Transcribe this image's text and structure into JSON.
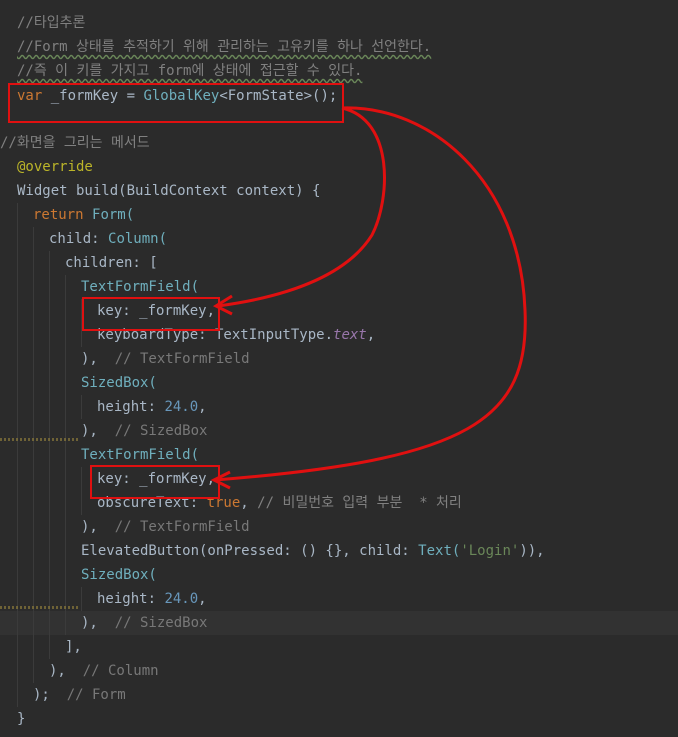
{
  "editor": {
    "lines": [
      {
        "id": "l1",
        "parts": [
          {
            "t": "//타입추론",
            "c": "c-comment"
          }
        ]
      },
      {
        "id": "l2",
        "parts": [
          {
            "t": "//Form 상태를 추적하기 위해 관리하는 고유키를 하나 선언한다.",
            "c": "c-comment"
          }
        ]
      },
      {
        "id": "l3",
        "parts": [
          {
            "t": "//즉 이 키를 가지고 form에 상태에 접근할 수 있다.",
            "c": "c-comment"
          }
        ]
      },
      {
        "id": "l4",
        "parts": [
          {
            "t": "var ",
            "c": "c-kw"
          },
          {
            "t": "_formKey",
            "c": "c-plain"
          },
          {
            "t": " = ",
            "c": "c-plain"
          },
          {
            "t": "GlobalKey",
            "c": "c-cls"
          },
          {
            "t": "<FormState>();",
            "c": "c-plain"
          }
        ]
      },
      {
        "id": "l5",
        "parts": []
      },
      {
        "id": "l6",
        "parts": [
          {
            "t": "//화면을 그리는 메서드",
            "c": "c-comment"
          }
        ]
      },
      {
        "id": "l7",
        "parts": [
          {
            "t": "@override",
            "c": "c-anno"
          }
        ]
      },
      {
        "id": "l8",
        "parts": [
          {
            "t": "Widget build(BuildContext context) {",
            "c": "c-plain"
          }
        ]
      },
      {
        "id": "l9",
        "parts": [
          {
            "t": "return ",
            "c": "c-kw"
          },
          {
            "t": "Form(",
            "c": "c-cls"
          }
        ]
      },
      {
        "id": "l10",
        "parts": [
          {
            "t": "child: ",
            "c": "c-plain"
          },
          {
            "t": "Column(",
            "c": "c-cls"
          }
        ]
      },
      {
        "id": "l11",
        "parts": [
          {
            "t": "children: [",
            "c": "c-plain"
          }
        ]
      },
      {
        "id": "l12",
        "parts": [
          {
            "t": "TextFormField(",
            "c": "c-cls"
          }
        ]
      },
      {
        "id": "l13",
        "parts": [
          {
            "t": "key: _formKey,",
            "c": "c-plain"
          }
        ]
      },
      {
        "id": "l14",
        "parts": [
          {
            "t": "keyboardType: TextInputType.",
            "c": "c-plain"
          },
          {
            "t": "text",
            "c": "c-field"
          },
          {
            "t": ",",
            "c": "c-plain"
          }
        ]
      },
      {
        "id": "l15",
        "parts": [
          {
            "t": "),  ",
            "c": "c-plain"
          },
          {
            "t": "// TextFormField",
            "c": "c-hint"
          }
        ]
      },
      {
        "id": "l16",
        "parts": [
          {
            "t": "SizedBox(",
            "c": "c-cls"
          }
        ]
      },
      {
        "id": "l17",
        "parts": [
          {
            "t": "height: ",
            "c": "c-plain"
          },
          {
            "t": "24.0",
            "c": "c-num"
          },
          {
            "t": ",",
            "c": "c-plain"
          }
        ]
      },
      {
        "id": "l18",
        "parts": [
          {
            "t": "),  ",
            "c": "c-plain"
          },
          {
            "t": "// SizedBox",
            "c": "c-hint"
          }
        ]
      },
      {
        "id": "l19",
        "parts": [
          {
            "t": "TextFormField(",
            "c": "c-cls"
          }
        ]
      },
      {
        "id": "l20",
        "parts": [
          {
            "t": "key: _formKey,",
            "c": "c-plain"
          }
        ]
      },
      {
        "id": "l21",
        "parts": [
          {
            "t": "obscureText: ",
            "c": "c-plain"
          },
          {
            "t": "true",
            "c": "c-kw"
          },
          {
            "t": ", ",
            "c": "c-plain"
          },
          {
            "t": "// 비밀번호 입력 부분  * 처리",
            "c": "c-comment"
          }
        ]
      },
      {
        "id": "l22",
        "parts": [
          {
            "t": "),  ",
            "c": "c-plain"
          },
          {
            "t": "// TextFormField",
            "c": "c-hint"
          }
        ]
      },
      {
        "id": "l23",
        "parts": [
          {
            "t": "ElevatedButton(onPressed: () {}, child: ",
            "c": "c-plain"
          },
          {
            "t": "Text(",
            "c": "c-cls"
          },
          {
            "t": "'Login'",
            "c": "c-str"
          },
          {
            "t": ")),",
            "c": "c-plain"
          }
        ]
      },
      {
        "id": "l24",
        "parts": [
          {
            "t": "SizedBox(",
            "c": "c-cls"
          }
        ]
      },
      {
        "id": "l25",
        "parts": [
          {
            "t": "height: ",
            "c": "c-plain"
          },
          {
            "t": "24.0",
            "c": "c-num"
          },
          {
            "t": ",",
            "c": "c-plain"
          }
        ]
      },
      {
        "id": "l26",
        "parts": [
          {
            "t": "),  ",
            "c": "c-plain"
          },
          {
            "t": "// SizedBox",
            "c": "c-hint"
          }
        ]
      },
      {
        "id": "l27",
        "parts": [
          {
            "t": "],",
            "c": "c-plain"
          }
        ]
      },
      {
        "id": "l28",
        "parts": [
          {
            "t": "),  ",
            "c": "c-plain"
          },
          {
            "t": "// Column",
            "c": "c-hint"
          }
        ]
      },
      {
        "id": "l29",
        "parts": [
          {
            "t": ");  ",
            "c": "c-plain"
          },
          {
            "t": "// Form",
            "c": "c-hint"
          }
        ]
      },
      {
        "id": "l30",
        "parts": [
          {
            "t": "}",
            "c": "c-plain"
          }
        ]
      }
    ]
  },
  "colors": {
    "background": "#2b2b2b",
    "keyword": "#cc7832",
    "class": "#6fafbd",
    "comment": "#808080",
    "string": "#6a8759",
    "annotation": "#bbb529",
    "annotation_box": "#e01010"
  }
}
